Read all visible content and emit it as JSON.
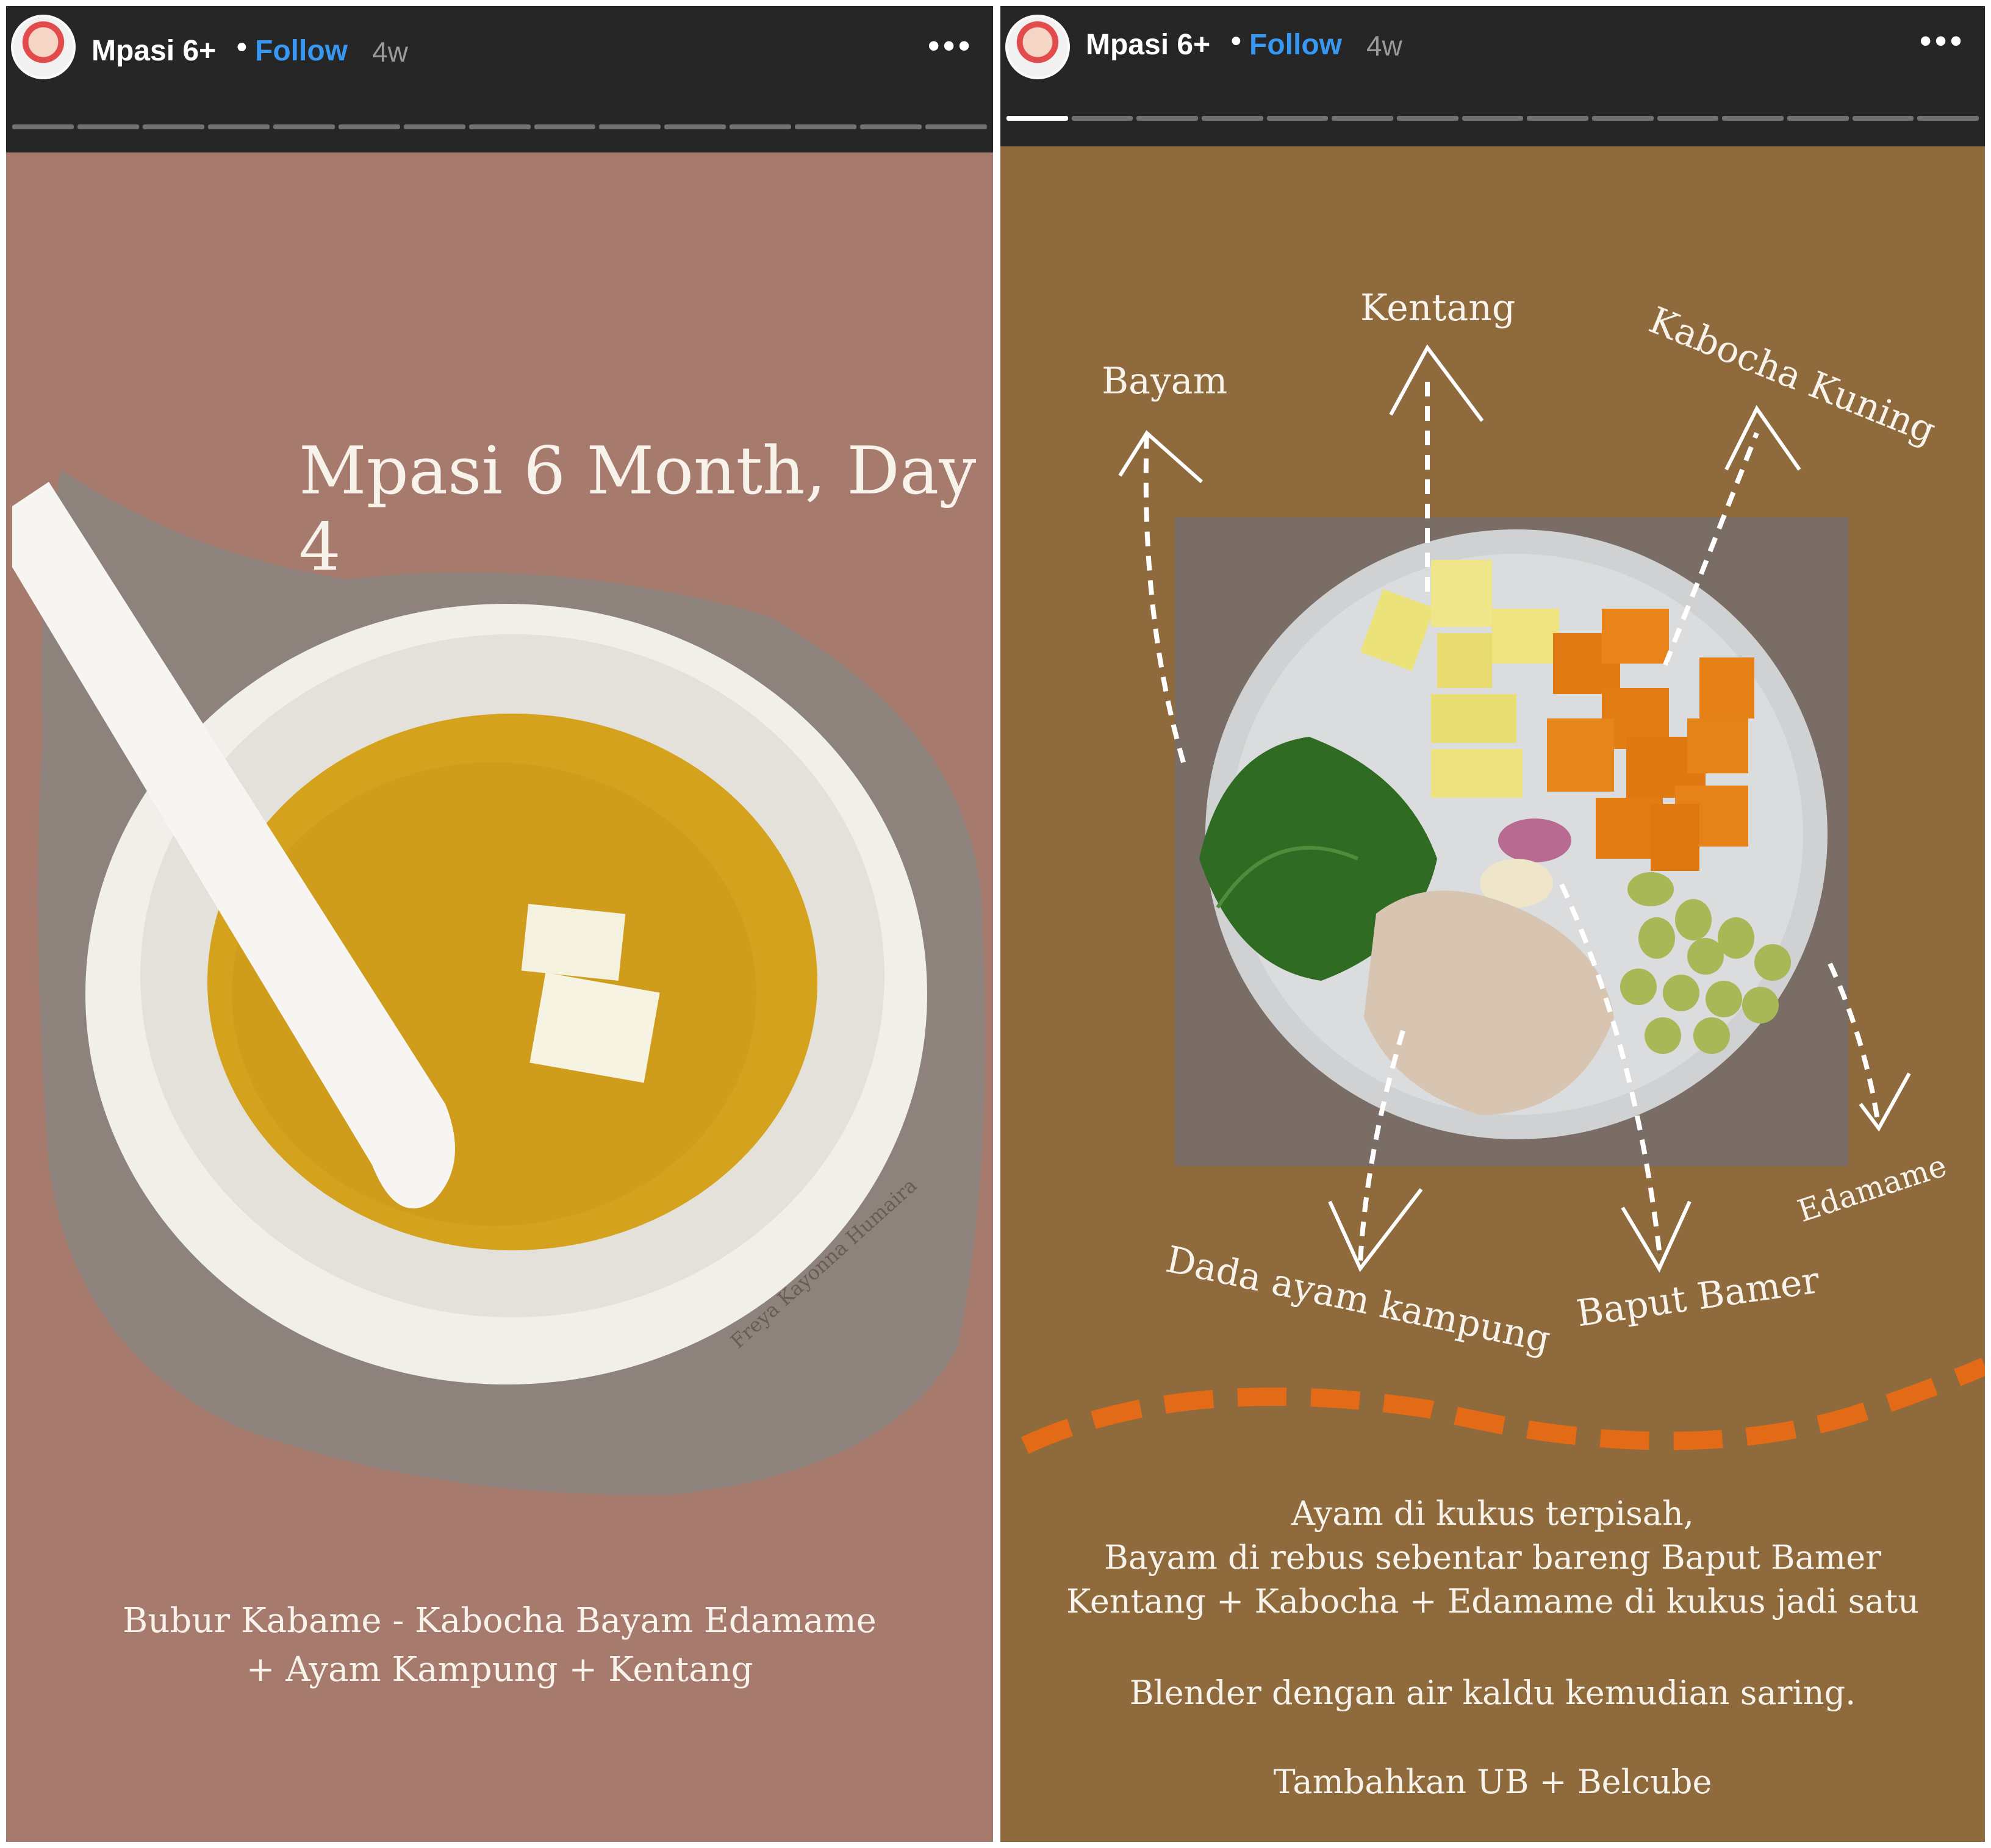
{
  "stories": [
    {
      "account": "Mpasi 6+",
      "separator": "•",
      "follow_label": "Follow",
      "age": "4w",
      "more_icon": "more-dots-icon",
      "title": "Mpasi 6 Month, Day 4",
      "caption_line1": "Bubur Kabame - Kabocha Bayam Edamame",
      "caption_line2": "+ Ayam Kampung + Kentang",
      "watermark": "Freya Kayonna Humaira",
      "progress_total": 15,
      "progress_active": 0
    },
    {
      "account": "Mpasi 6+",
      "separator": "•",
      "follow_label": "Follow",
      "age": "4w",
      "more_icon": "more-dots-icon",
      "labels": {
        "bayam": "Bayam",
        "kentang": "Kentang",
        "kabocha": "Kabocha Kuning",
        "dada_ayam": "Dada ayam kampung",
        "baput_bamer": "Baput Bamer",
        "edamame": "Edamame"
      },
      "steps": [
        "Ayam di kukus terpisah,",
        "Bayam di rebus sebentar bareng Baput Bamer",
        "Kentang + Kabocha + Edamame di kukus jadi satu",
        "Blender dengan air kaldu kemudian saring.",
        "Tambahkan UB + Belcube"
      ],
      "progress_total": 15,
      "progress_active": 1
    }
  ],
  "colors": {
    "story_left_bg": "#a67a6c",
    "story_right_bg": "#8e6a3d",
    "header_bg": "#262626",
    "follow_blue": "#3897f0",
    "puree_yellow": "#d4a21c",
    "dash_orange": "#e36a16"
  }
}
